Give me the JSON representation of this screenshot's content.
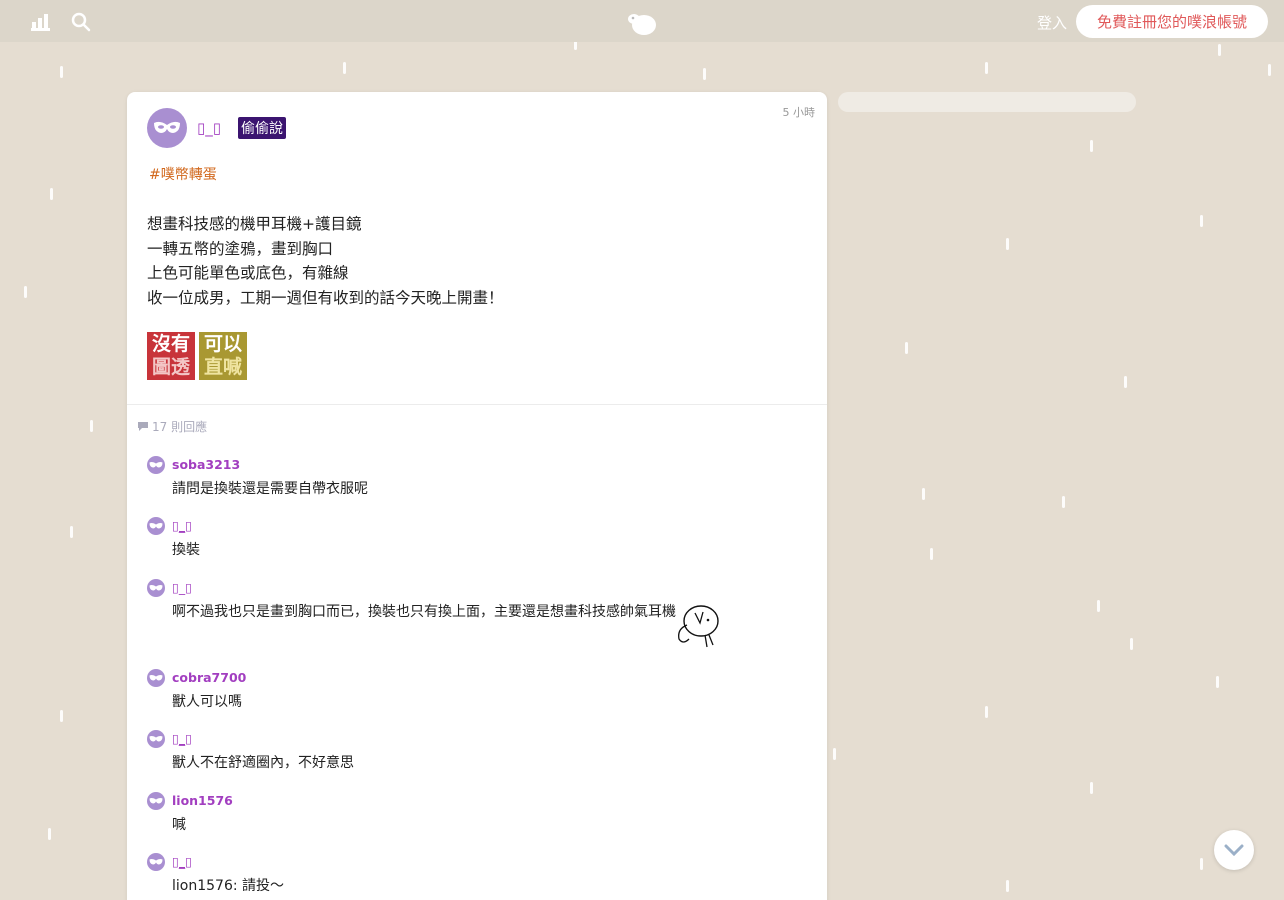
{
  "topbar": {
    "login_label": "登入",
    "signup_label": "免費註冊您的噗浪帳號"
  },
  "post": {
    "time": "5 小時",
    "author": "▯_▯",
    "badge": "偷偷說",
    "hashtag": "#噗幣轉蛋",
    "lines": [
      "想畫科技感的機甲耳機+護目鏡",
      "一轉五幣的塗鴉，畫到胸口",
      "上色可能單色或底色，有雜線",
      "收一位成男，工期一週但有收到的話今天晚上開畫！"
    ],
    "stamps": [
      {
        "top": "沒有",
        "bottom": "圖透",
        "color": "#c8343a"
      },
      {
        "top": "可以",
        "bottom": "直喊",
        "color": "#a99832"
      }
    ],
    "reply_count": "17 則回應"
  },
  "replies": [
    {
      "name": "soba3213",
      "msg": "請問是換裝還是需要自帶衣服呢"
    },
    {
      "name": "▯_▯",
      "msg": "換裝"
    },
    {
      "name": "▯_▯",
      "msg": "啊不過我也只是畫到胸口而已，換裝也只有換上面，主要還是想畫科技感帥氣耳機"
    },
    {
      "name": "cobra7700",
      "msg": "獸人可以嗎"
    },
    {
      "name": "▯_▯",
      "msg": "獸人不在舒適圈內，不好意思"
    },
    {
      "name": "lion1576",
      "msg": "喊"
    },
    {
      "name": "▯_▯",
      "msg": "lion1576: 請投～"
    }
  ],
  "colors": {
    "background": "#e5ddd1",
    "accent": "#a23ec0",
    "signup_text": "#e0595a",
    "badge_bg": "#3b1470"
  }
}
